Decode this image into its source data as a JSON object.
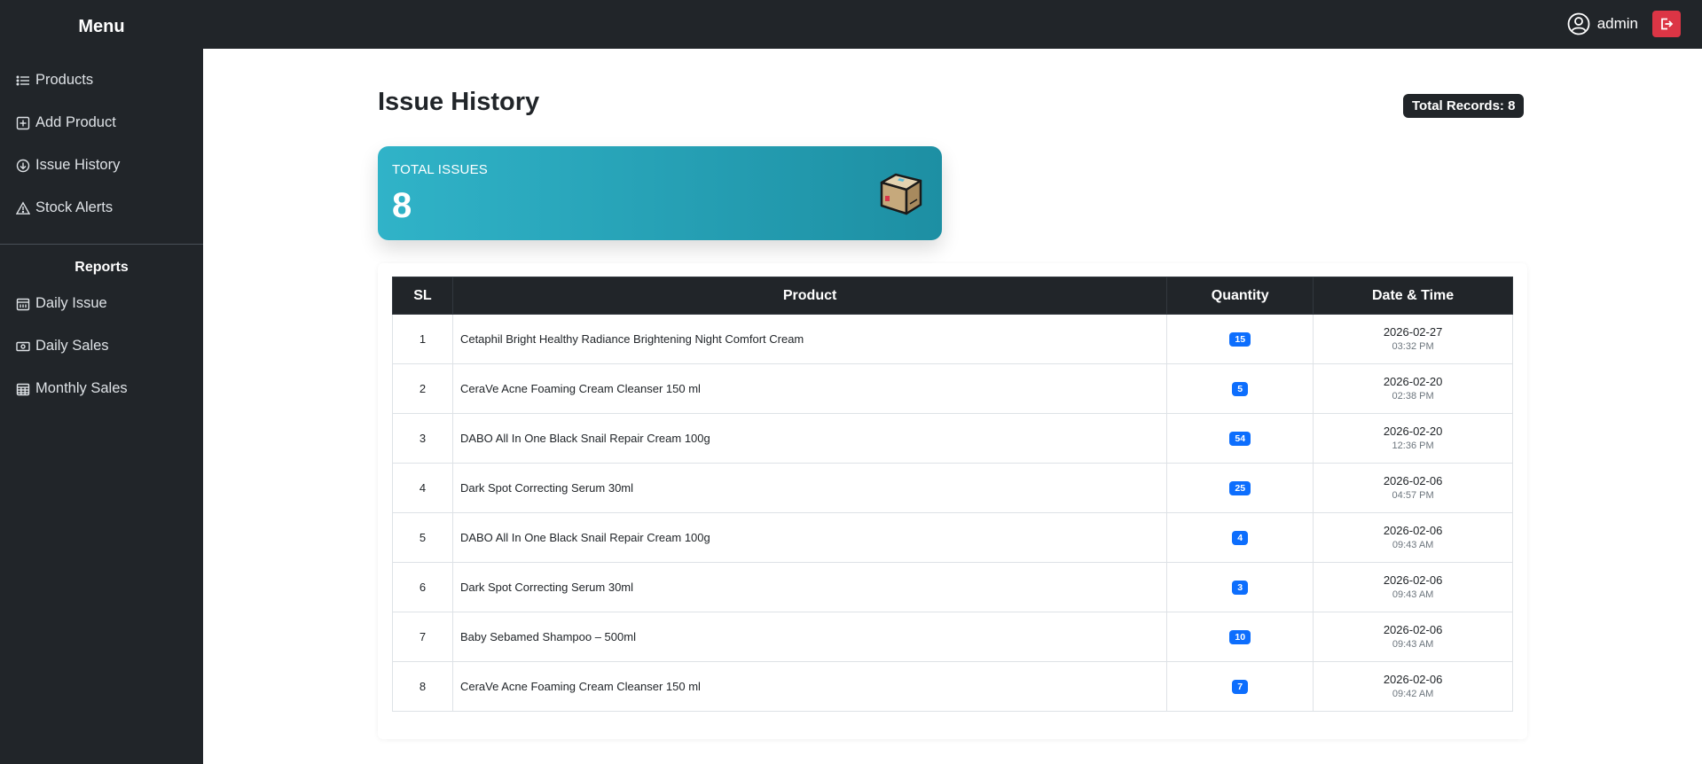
{
  "sidebar": {
    "title": "Menu",
    "items": [
      {
        "label": "Products",
        "icon": "list-icon"
      },
      {
        "label": "Add Product",
        "icon": "plus-square-icon"
      },
      {
        "label": "Issue History",
        "icon": "download-circle-icon"
      },
      {
        "label": "Stock Alerts",
        "icon": "warning-triangle-icon"
      }
    ],
    "reports_title": "Reports",
    "reports": [
      {
        "label": "Daily Issue",
        "icon": "calendar-icon"
      },
      {
        "label": "Daily Sales",
        "icon": "cash-icon"
      },
      {
        "label": "Monthly Sales",
        "icon": "calendar-grid-icon"
      }
    ]
  },
  "header": {
    "username": "admin",
    "user_icon": "user-circle-icon",
    "logout_icon": "logout-icon"
  },
  "main": {
    "title": "Issue History",
    "total_records": "Total Records: 8",
    "stat": {
      "label": "TOTAL ISSUES",
      "value": "8",
      "icon": "package-box-icon"
    },
    "table": {
      "columns": [
        "SL",
        "Product",
        "Quantity",
        "Date & Time"
      ],
      "rows": [
        {
          "sl": "1",
          "product": "Cetaphil Bright Healthy Radiance Brightening Night Comfort Cream",
          "qty": "15",
          "date": "2026-02-27",
          "time": "03:32 PM"
        },
        {
          "sl": "2",
          "product": "CeraVe Acne Foaming Cream Cleanser 150 ml",
          "qty": "5",
          "date": "2026-02-20",
          "time": "02:38 PM"
        },
        {
          "sl": "3",
          "product": "DABO All In One Black Snail Repair Cream 100g",
          "qty": "54",
          "date": "2026-02-20",
          "time": "12:36 PM"
        },
        {
          "sl": "4",
          "product": "Dark Spot Correcting Serum 30ml",
          "qty": "25",
          "date": "2026-02-06",
          "time": "04:57 PM"
        },
        {
          "sl": "5",
          "product": "DABO All In One Black Snail Repair Cream 100g",
          "qty": "4",
          "date": "2026-02-06",
          "time": "09:43 AM"
        },
        {
          "sl": "6",
          "product": "Dark Spot Correcting Serum 30ml",
          "qty": "3",
          "date": "2026-02-06",
          "time": "09:43 AM"
        },
        {
          "sl": "7",
          "product": "Baby Sebamed Shampoo – 500ml",
          "qty": "10",
          "date": "2026-02-06",
          "time": "09:43 AM"
        },
        {
          "sl": "8",
          "product": "CeraVe Acne Foaming Cream Cleanser 150 ml",
          "qty": "7",
          "date": "2026-02-06",
          "time": "09:42 AM"
        }
      ]
    }
  },
  "colors": {
    "sidebar_bg": "#212529",
    "card_gradient_start": "#30b3c8",
    "card_gradient_end": "#1d8fa3",
    "badge_blue": "#0d6efd",
    "logout_red": "#dc3545"
  }
}
